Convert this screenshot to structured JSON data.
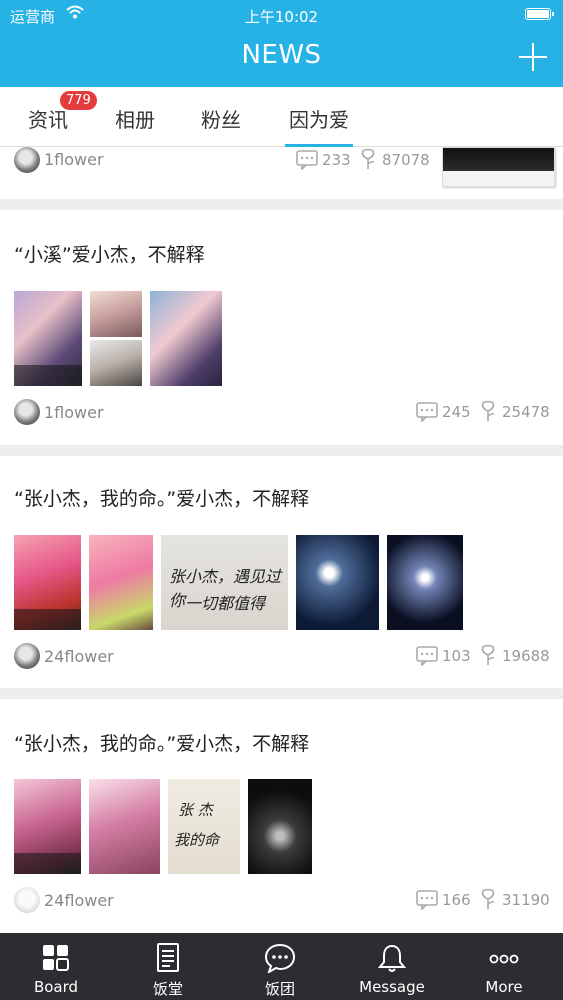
{
  "status_bar": {
    "carrier": "运营商",
    "time": "上午10:02"
  },
  "nav": {
    "title": "NEWS"
  },
  "tabs": [
    {
      "label": "资讯",
      "badge": "779"
    },
    {
      "label": "相册"
    },
    {
      "label": "粉丝"
    },
    {
      "label": "因为爱",
      "active": true
    }
  ],
  "feed": {
    "partial_post": {
      "user": "1flower",
      "comments": "233",
      "likes": "87078"
    },
    "posts": [
      {
        "title": "“小溪”爱小杰，不解释",
        "user": "1flower",
        "comments": "245",
        "likes": "25478"
      },
      {
        "title": "“张小杰，我的命。”爱小杰，不解释",
        "user": "24flower",
        "comments": "103",
        "likes": "19688"
      },
      {
        "title": "“张小杰，我的命。”爱小杰，不解释",
        "user": "24flower",
        "comments": "166",
        "likes": "31190"
      }
    ]
  },
  "tabbar": [
    {
      "label": "Board",
      "icon": "grid-icon"
    },
    {
      "label": "饭堂",
      "icon": "document-icon"
    },
    {
      "label": "饭团",
      "icon": "chat-bubble-icon"
    },
    {
      "label": "Message",
      "icon": "bell-icon"
    },
    {
      "label": "More",
      "icon": "more-dots-icon"
    }
  ],
  "colors": {
    "accent": "#27b2e6",
    "badge": "#e43c3c",
    "tabbar_bg": "#2c2d31",
    "background": "#eeeeee"
  }
}
